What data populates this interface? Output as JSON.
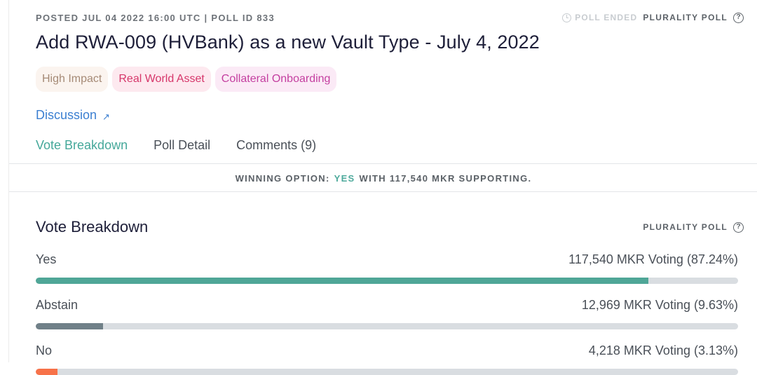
{
  "header": {
    "meta": "POSTED JUL 04 2022 16:00 UTC | POLL ID 833",
    "status": "POLL ENDED",
    "poll_type": "PLURALITY POLL"
  },
  "title": "Add RWA-009 (HVBank) as a new Vault Type - July 4, 2022",
  "tags": [
    {
      "label": "High Impact"
    },
    {
      "label": "Real World Asset"
    },
    {
      "label": "Collateral Onboarding"
    }
  ],
  "discussion_link": "Discussion",
  "tabs": [
    {
      "label": "Vote Breakdown"
    },
    {
      "label": "Poll Detail"
    },
    {
      "label": "Comments (9)"
    }
  ],
  "winning": {
    "prefix": "WINNING OPTION:",
    "option": "YES",
    "suffix": "WITH 117,540 MKR SUPPORTING."
  },
  "breakdown": {
    "title": "Vote Breakdown",
    "poll_type": "PLURALITY POLL",
    "options": [
      {
        "label": "Yes",
        "value": "117,540 MKR Voting (87.24%)",
        "percent": 87.24,
        "color": "#4fa697"
      },
      {
        "label": "Abstain",
        "value": "12,969 MKR Voting (9.63%)",
        "percent": 9.63,
        "color": "#708088"
      },
      {
        "label": "No",
        "value": "4,218 MKR Voting (3.13%)",
        "percent": 3.13,
        "color": "#f77249"
      }
    ]
  },
  "icons": {
    "status": "clock-icon",
    "help": "help-circle-icon",
    "discussion": "external-link-icon"
  }
}
